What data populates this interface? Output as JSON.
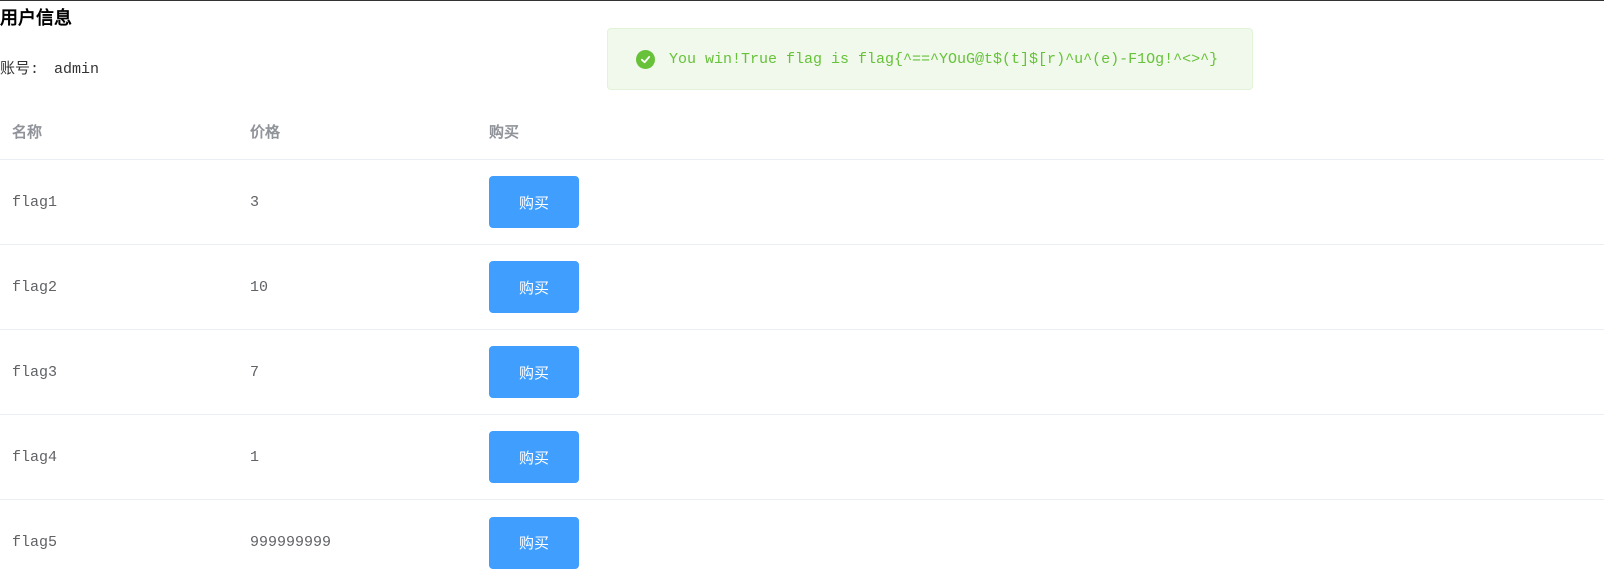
{
  "page": {
    "title": "用户信息",
    "account_label": "账号:",
    "account_value": "admin"
  },
  "alert": {
    "type": "success",
    "icon": "check-circle-icon",
    "message": "You win!True flag is flag{^==^YOuG@t$(t]$[r)^u^(e)-F1Og!^<>^}",
    "color": "#67c23a"
  },
  "table": {
    "headers": {
      "name": "名称",
      "price": "价格",
      "buy": "购买"
    },
    "rows": [
      {
        "name": "flag1",
        "price": "3",
        "button": "购买"
      },
      {
        "name": "flag2",
        "price": "10",
        "button": "购买"
      },
      {
        "name": "flag3",
        "price": "7",
        "button": "购买"
      },
      {
        "name": "flag4",
        "price": "1",
        "button": "购买"
      },
      {
        "name": "flag5",
        "price": "999999999",
        "button": "购买"
      }
    ]
  },
  "colors": {
    "button": "#409eff",
    "alert_bg": "#f0f9eb"
  }
}
